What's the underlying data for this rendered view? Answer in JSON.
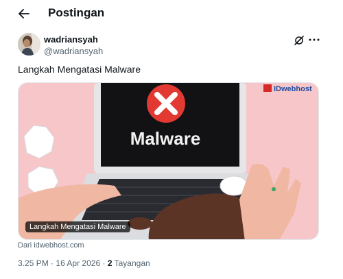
{
  "header": {
    "title": "Postingan",
    "back_icon": "arrow-left-icon"
  },
  "author": {
    "display_name": "wadriansyah",
    "handle": "@wadriansyah"
  },
  "actions": {
    "grok_icon": "grok-icon",
    "more_icon": "more-dots-icon"
  },
  "tweet": {
    "text": "Langkah Mengatasi Malware"
  },
  "media": {
    "screen_text": "Malware",
    "brand": "IDwebhost",
    "caption": "Langkah Mengatasi Malware",
    "colors": {
      "background": "#f6c6c9",
      "error_red": "#e23a32",
      "brand_red": "#d42a2a",
      "brand_blue": "#1f4da2"
    }
  },
  "source": {
    "text": "Dari idwebhost.com"
  },
  "meta": {
    "time": "3.25 PM",
    "separator": "·",
    "date": "16 Apr 2026",
    "views_count": "2",
    "views_label": "Tayangan"
  }
}
